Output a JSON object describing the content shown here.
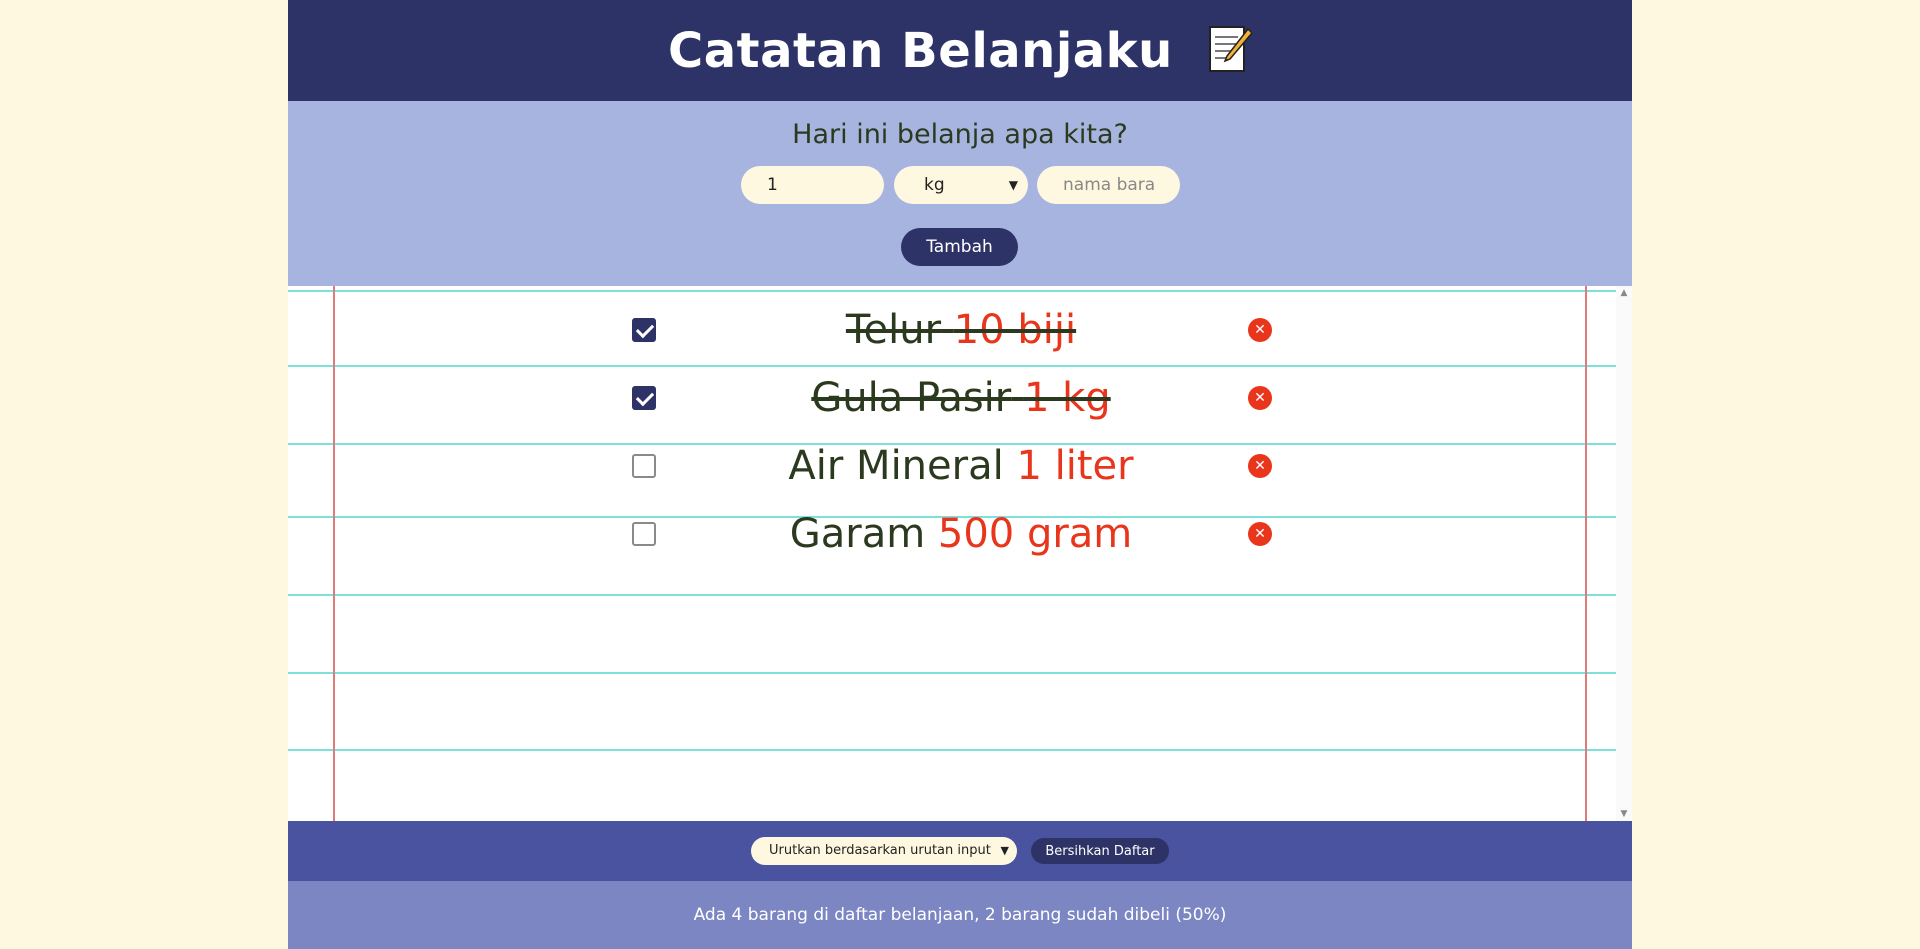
{
  "header": {
    "title": "Catatan Belanjaku",
    "icon": "memo-icon"
  },
  "form": {
    "question": "Hari ini belanja apa kita?",
    "quantity_value": "1",
    "unit_value": "kg",
    "name_placeholder": "nama bara",
    "add_label": "Tambah"
  },
  "items": [
    {
      "name": "Telur",
      "amount": "10 biji",
      "checked": true
    },
    {
      "name": "Gula Pasir",
      "amount": "1 kg",
      "checked": true
    },
    {
      "name": "Air Mineral",
      "amount": "1 liter",
      "checked": false
    },
    {
      "name": "Garam",
      "amount": "500 gram",
      "checked": false
    }
  ],
  "footer": {
    "sort_value": "Urutkan berdasarkan urutan input",
    "clear_label": "Bersihkan Daftar"
  },
  "stats": {
    "text": "Ada 4 barang di daftar belanjaan, 2 barang sudah dibeli (50%)"
  },
  "colors": {
    "header_bg": "#2d3366",
    "form_bg": "#a7b4e0",
    "page_bg": "#fff8e1",
    "accent_red": "#e8351b",
    "footer_bg": "#4a53a0",
    "stats_bg": "#7b86c2"
  }
}
